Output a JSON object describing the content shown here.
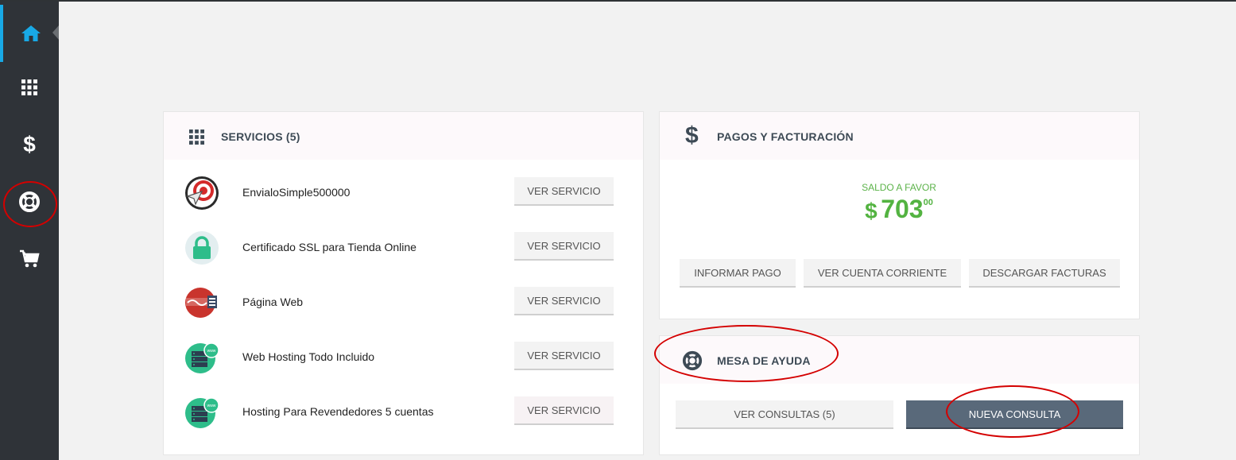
{
  "sidebar": {
    "items": [
      {
        "icon": "home-icon",
        "active": true
      },
      {
        "icon": "grid-icon"
      },
      {
        "icon": "dollar-icon",
        "glyph": "$"
      },
      {
        "icon": "lifebuoy-icon"
      },
      {
        "icon": "cart-icon"
      }
    ]
  },
  "services": {
    "title": "SERVICIOS (5)",
    "button_label": "VER SERVICIO",
    "items": [
      {
        "name": "EnvialoSimple500000",
        "icon": "paper-plane-target-icon"
      },
      {
        "name": "Certificado SSL para Tienda Online",
        "icon": "padlock-icon"
      },
      {
        "name": "Página Web",
        "icon": "sitiosimple-logo-icon"
      },
      {
        "name": "Web Hosting Todo Incluido",
        "icon": "server-www-icon"
      },
      {
        "name": "Hosting Para Revendedores 5 cuentas",
        "icon": "server-www-icon"
      }
    ]
  },
  "payments": {
    "title": "PAGOS Y FACTURACIÓN",
    "icon_glyph": "$",
    "balance_label": "SALDO A FAVOR",
    "balance_currency": "$",
    "balance_amount": "703",
    "balance_cents": "00",
    "buttons": [
      "INFORMAR PAGO",
      "VER CUENTA CORRIENTE",
      "DESCARGAR FACTURAS"
    ]
  },
  "helpdesk": {
    "title": "MESA DE AYUDA",
    "view_label": "VER CONSULTAS (5)",
    "new_label": "NUEVA CONSULTA"
  },
  "colors": {
    "sidebar_bg": "#2f3338",
    "accent": "#18a9e6",
    "balance_green": "#53b341",
    "dark_button": "#59697a",
    "annotation_red": "#d40000"
  }
}
